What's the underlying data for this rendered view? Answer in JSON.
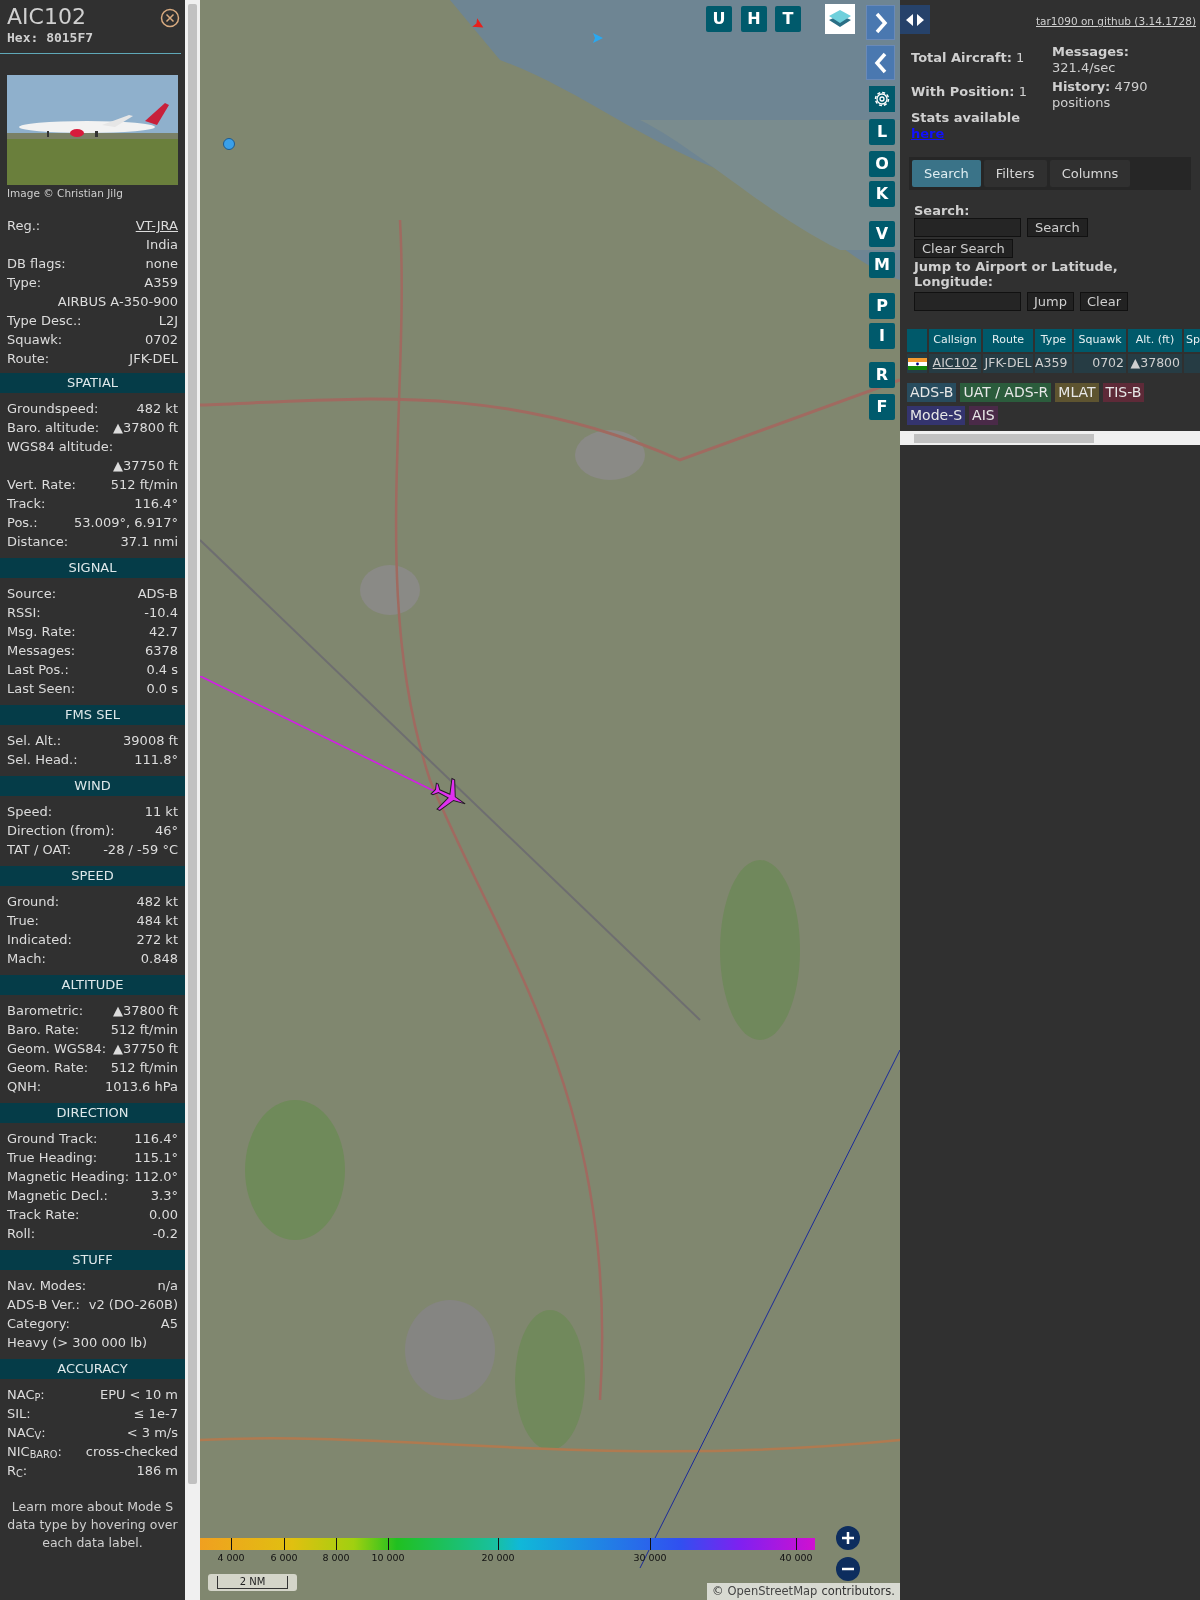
{
  "detail": {
    "callsign": "AIC102",
    "hex": "Hex: 8015F7",
    "photo_credit": "Image © Christian Jilg",
    "top_rows": [
      {
        "kind": "link",
        "label": "Reg.:",
        "value": "VT-JRA"
      },
      {
        "kind": "value",
        "value": "India"
      },
      {
        "kind": "pair",
        "label": "DB flags:",
        "value": "none"
      },
      {
        "kind": "pair",
        "label": "Type:",
        "value": "A359"
      },
      {
        "kind": "value",
        "value": "AIRBUS A-350-900"
      },
      {
        "kind": "pair",
        "label": "Type Desc.:",
        "value": "L2J"
      },
      {
        "kind": "pair",
        "label": "Squawk:",
        "value": "0702"
      },
      {
        "kind": "pair",
        "label": "Route:",
        "value": "JFK-DEL"
      }
    ],
    "sections": [
      {
        "title": "SPATIAL",
        "rows": [
          {
            "kind": "pair",
            "label": "Groundspeed:",
            "value": "482 kt"
          },
          {
            "kind": "pair",
            "label": "Baro. altitude:",
            "value": "▲37800 ft"
          },
          {
            "kind": "label",
            "label": "WGS84 altitude:"
          },
          {
            "kind": "value",
            "value": "▲37750 ft"
          },
          {
            "kind": "pair",
            "label": "Vert. Rate:",
            "value": "512 ft/min"
          },
          {
            "kind": "pair",
            "label": "Track:",
            "value": "116.4°"
          },
          {
            "kind": "pair",
            "label": "Pos.:",
            "value": "53.009°, 6.917°"
          },
          {
            "kind": "pair",
            "label": "Distance:",
            "value": "37.1 nmi"
          }
        ]
      },
      {
        "title": "SIGNAL",
        "rows": [
          {
            "kind": "pair",
            "label": "Source:",
            "value": "ADS-B"
          },
          {
            "kind": "pair",
            "label": "RSSI:",
            "value": "-10.4"
          },
          {
            "kind": "pair",
            "label": "Msg. Rate:",
            "value": "42.7"
          },
          {
            "kind": "pair",
            "label": "Messages:",
            "value": "6378"
          },
          {
            "kind": "pair",
            "label": "Last Pos.:",
            "value": "0.4 s"
          },
          {
            "kind": "pair",
            "label": "Last Seen:",
            "value": "0.0 s"
          }
        ]
      },
      {
        "title": "FMS SEL",
        "rows": [
          {
            "kind": "pair",
            "label": "Sel. Alt.:",
            "value": "39008 ft"
          },
          {
            "kind": "pair",
            "label": "Sel. Head.:",
            "value": "111.8°"
          }
        ]
      },
      {
        "title": "WIND",
        "rows": [
          {
            "kind": "pair",
            "label": "Speed:",
            "value": "11 kt"
          },
          {
            "kind": "pair",
            "label": "Direction (from):",
            "value": "46°"
          },
          {
            "kind": "pair",
            "label": "TAT / OAT:",
            "value": "-28 / -59 °C"
          }
        ]
      },
      {
        "title": "SPEED",
        "rows": [
          {
            "kind": "pair",
            "label": "Ground:",
            "value": "482 kt"
          },
          {
            "kind": "pair",
            "label": "True:",
            "value": "484 kt"
          },
          {
            "kind": "pair",
            "label": "Indicated:",
            "value": "272 kt"
          },
          {
            "kind": "pair",
            "label": "Mach:",
            "value": "0.848"
          }
        ]
      },
      {
        "title": "ALTITUDE",
        "rows": [
          {
            "kind": "pair",
            "label": "Barometric:",
            "value": "▲37800 ft"
          },
          {
            "kind": "pair",
            "label": "Baro. Rate:",
            "value": "512 ft/min"
          },
          {
            "kind": "pair",
            "label": "Geom. WGS84:",
            "value": "▲37750 ft"
          },
          {
            "kind": "pair",
            "label": "Geom. Rate:",
            "value": "512 ft/min"
          },
          {
            "kind": "pair",
            "label": "QNH:",
            "value": "1013.6 hPa"
          }
        ]
      },
      {
        "title": "DIRECTION",
        "rows": [
          {
            "kind": "pair",
            "label": "Ground Track:",
            "value": "116.4°"
          },
          {
            "kind": "pair",
            "label": "True Heading:",
            "value": "115.1°"
          },
          {
            "kind": "pair",
            "label": "Magnetic Heading:",
            "value": "112.0°"
          },
          {
            "kind": "pair",
            "label": "Magnetic Decl.:",
            "value": "3.3°"
          },
          {
            "kind": "pair",
            "label": "Track Rate:",
            "value": "0.00"
          },
          {
            "kind": "pair",
            "label": "Roll:",
            "value": "-0.2"
          }
        ]
      },
      {
        "title": "STUFF",
        "rows": [
          {
            "kind": "pair",
            "label": "Nav. Modes:",
            "value": "n/a"
          },
          {
            "kind": "pair",
            "label": "ADS-B Ver.:",
            "value": "v2 (DO-260B)"
          },
          {
            "kind": "pair",
            "label": "Category:",
            "value": "A5"
          },
          {
            "kind": "label",
            "label": "Heavy (> 300 000 lb)"
          }
        ]
      },
      {
        "title": "ACCURACY",
        "rows": [
          {
            "kind": "pair",
            "label": "NAC$_{P}$:",
            "value": "EPU < 10 m"
          },
          {
            "kind": "pair",
            "label": "SIL:",
            "value": "≤ 1e-7"
          },
          {
            "kind": "pair",
            "label": "NAC$_{V}$:",
            "value": "< 3 m/s"
          },
          {
            "kind": "pair",
            "label": "NIC$_{BARO}$:",
            "value": "cross-checked"
          },
          {
            "kind": "pair",
            "label": "R$_{C}$:",
            "value": "186 m"
          }
        ]
      }
    ],
    "footer": "Learn more about Mode S data type by hovering over each data label."
  },
  "map": {
    "top_buttons": [
      "U",
      "H",
      "T"
    ],
    "side_buttons": [
      "L",
      "O",
      "K",
      "V",
      "M",
      "P",
      "I",
      "R",
      "F"
    ],
    "legend": [
      "4 000",
      "6 000",
      "8 000",
      "10 000",
      "20 000",
      "30 000",
      "40 000"
    ],
    "scale": "2 NM",
    "attribution": {
      "prefix": "©",
      "link": "OpenStreetMap",
      "suffix": "contributors."
    }
  },
  "sidebar": {
    "github_link": "tar1090 on github (3.14.1728)",
    "stats": {
      "total": "**Total Aircraft:** 1",
      "with_position": "**With Position:** 1",
      "messages": "**Messages:** 321.4/sec",
      "history": "**History:** 4790 positions",
      "stats_label": "Stats available",
      "stats_link": "here"
    },
    "tabs": [
      {
        "label": "Search",
        "selected": true
      },
      {
        "label": "Filters",
        "selected": false
      },
      {
        "label": "Columns",
        "selected": false
      }
    ],
    "search_label": "Search:",
    "search_button": "Search",
    "clear_search_button": "Clear Search",
    "jump_label": "Jump to Airport or Latitude, Longitude:",
    "jump_button": "Jump",
    "clear_button": "Clear",
    "table": {
      "columns": [
        "Callsign",
        "Route",
        "Type",
        "Squawk",
        "Alt. (ft)",
        "Sp"
      ],
      "rows": [
        {
          "callsign": "AIC102",
          "route": "JFK-DEL",
          "type": "A359",
          "squawk": "0702",
          "altitude": "▲37800"
        }
      ]
    },
    "sources": [
      {
        "label": "ADS-B",
        "color": "#284c5e"
      },
      {
        "label": "UAT / ADS-R",
        "color": "#2b5c3c"
      },
      {
        "label": "MLAT",
        "color": "#5e5430"
      },
      {
        "label": "TIS-B",
        "color": "#5e2a38"
      },
      {
        "label": "Mode-S",
        "color": "#34346e"
      },
      {
        "label": "AIS",
        "color": "#4a2a48"
      }
    ]
  }
}
